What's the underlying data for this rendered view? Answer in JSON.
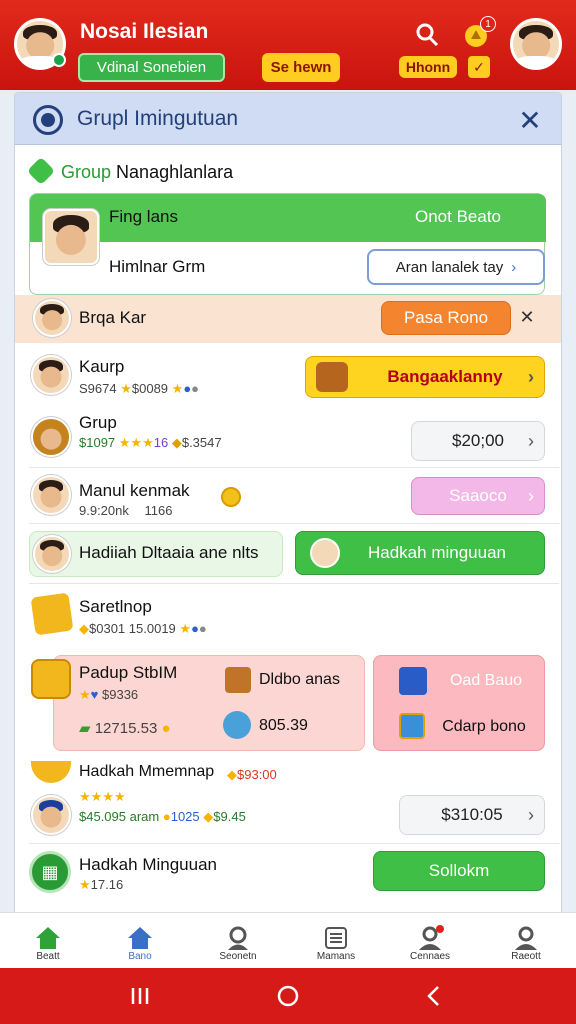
{
  "header": {
    "title": "Nosai Ilesian",
    "green_pill": "Vdinal Sonebien",
    "yellow_pill": "Se hewn",
    "yellow_pill2": "Hhonn",
    "notif_count": "1"
  },
  "panel": {
    "title": "Grupl Imingutuan",
    "section_label": "Group",
    "section_title": "Nanaghlanlara"
  },
  "rows": {
    "r1": {
      "name": "Fing lans",
      "button": "Onot Beato"
    },
    "r2": {
      "name": "Himlnar Grm",
      "button": "Aran lanalek tay"
    },
    "r3": {
      "name": "Brqa Kar",
      "button": "Pasa Rono"
    },
    "r4": {
      "name": "Kaurp",
      "sub": "S9674",
      "sub2": "$0089",
      "button": "Bangaaklanny"
    },
    "r5": {
      "name": "Grup",
      "sub": "$1097",
      "sub2": "16",
      "sub3": "$.3547",
      "button": "$20;00"
    },
    "r6": {
      "name": "Manul kenmak",
      "sub": "9.9:20nk",
      "sub2": "1166",
      "button": "Saaoco"
    },
    "r7": {
      "name": "Hadiiah Dltaaia ane nlts",
      "button": "Hadkah minguuan"
    },
    "r8": {
      "name": "Saretlnop",
      "sub": "$0301",
      "sub2": "15.0019"
    },
    "r9": {
      "name": "Padup StbIM",
      "sub": "$9336",
      "sub2": "12715.53",
      "mid1": "Dldbo anas",
      "mid2": "805.39",
      "btn1": "Oad Bauo",
      "btn2": "Cdarp bono"
    },
    "r10": {
      "name": "Hadkah Mmemnap",
      "sub": "$93:00",
      "sub2": "$45.095 aram",
      "sub3": "1025",
      "sub4": "$9.45",
      "button": "$310:05"
    },
    "r11": {
      "name": "Hadkah Minguuan",
      "sub": "17.16",
      "button": "Sollokm"
    }
  },
  "tabs": [
    "Beatt",
    "Bano",
    "Seonetn",
    "Mamans",
    "Cennaes",
    "Raeott"
  ],
  "colors": {
    "brand_red": "#d61a17",
    "green": "#3fbf45",
    "yellow": "#ffd420"
  }
}
